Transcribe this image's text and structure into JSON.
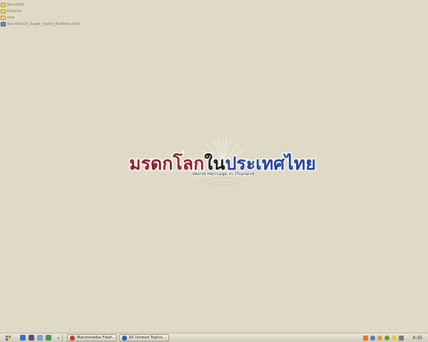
{
  "desktop": {
    "icons": [
      {
        "label": "ServiOfie",
        "type": "folder"
      },
      {
        "label": "Entorno",
        "type": "folder"
      },
      {
        "label": "new",
        "type": "folder"
      },
      {
        "label": "Soundtrack_Super_mario_Brothers.mp3",
        "type": "audio-file"
      }
    ]
  },
  "logo": {
    "thai_title": "มรดกโลกในประเทศไทย",
    "subtitle": "World Heritage in Thailand",
    "colors": {
      "red": "#8a1f2a",
      "black": "#1a1a1a",
      "blue": "#243f99"
    }
  },
  "taskbar": {
    "start_icon": "windows-flag-icon",
    "quicklaunch": [
      "ie-icon",
      "media-icon",
      "desktop-icon",
      "app-icon"
    ],
    "overflow": "»",
    "tasks": [
      {
        "label": "Macromedia Flash...",
        "icon": "flash-icon",
        "color": "#c8342a"
      },
      {
        "label": "All Unread Topics...",
        "icon": "firefox-icon",
        "color": "#2a5db0"
      }
    ],
    "tray_icons": [
      "th-language-icon",
      "network-icon",
      "firefox-tray-icon",
      "user-icon",
      "messenger-icon",
      "volume-icon"
    ],
    "clock": "0:35"
  }
}
